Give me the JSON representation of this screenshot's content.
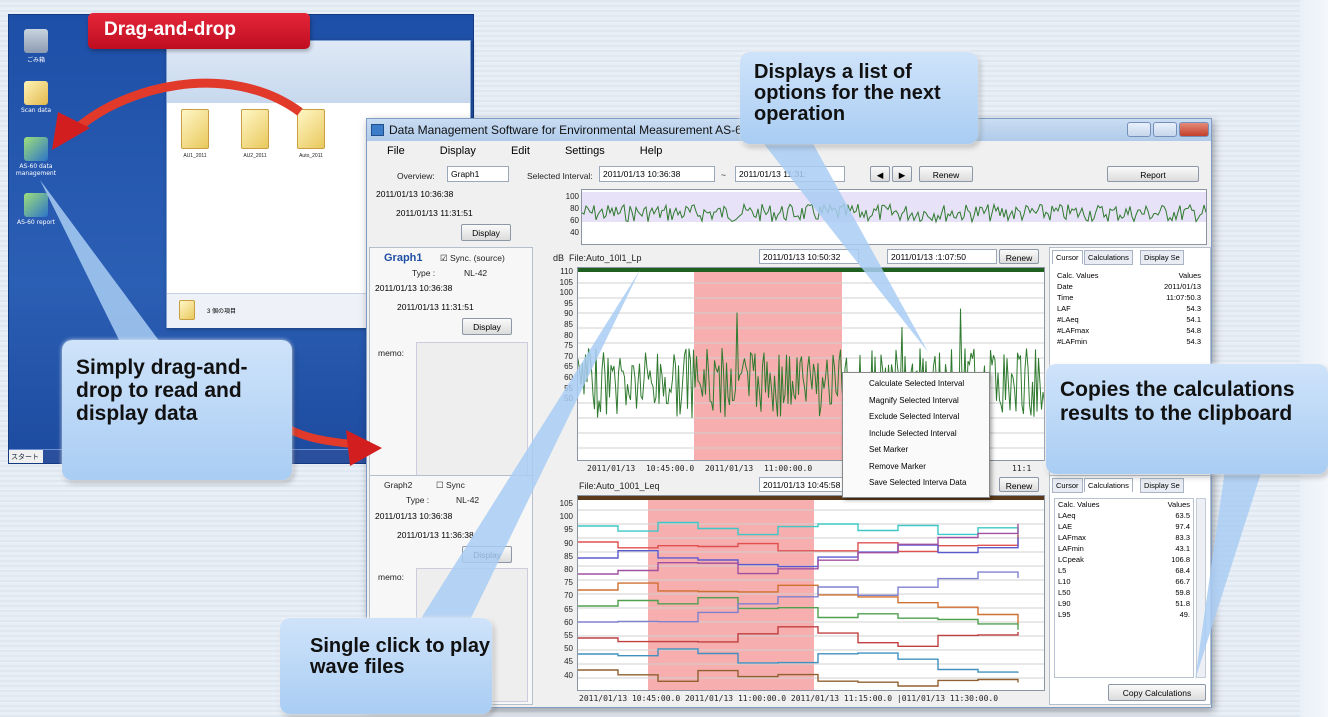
{
  "banner": {
    "drag_and_drop": "Drag-and-drop"
  },
  "callouts": {
    "options": "Displays a list of options for the next operation",
    "simply": "Simply drag-and-drop to read and display data",
    "copies": "Copies the calculations results to the clipboard",
    "single_click": "Single click to play wave files"
  },
  "window": {
    "title": "Data Management Software for Environmental Measurement AS-60 Da",
    "menu": [
      "File",
      "Display",
      "Edit",
      "Settings",
      "Help"
    ]
  },
  "overview": {
    "label": "Overview:",
    "select": "Graph1",
    "selected_interval_label": "Selected Interval:",
    "interval_from": "2011/01/13 10:36:38",
    "tilde": "~",
    "interval_to": "2011/01/13 11:31:",
    "renew": "Renew",
    "report": "Report",
    "date_from": "2011/01/13 10:36:38",
    "date_to": "2011/01/13 11:31:51",
    "display": "Display",
    "yticks": [
      "100",
      "80",
      "60",
      "40"
    ]
  },
  "graph1": {
    "title": "Graph1",
    "sync": "Sync. (source)",
    "type_label": "Type :",
    "type": "NL-42",
    "date_from": "2011/01/13 10:36:38",
    "date_to": "2011/01/13 11:31:51",
    "display": "Display",
    "memo": "memo:",
    "unit": "dB",
    "file": "File:Auto_10l1_Lp",
    "from": "2011/01/13 10:50:32",
    "to": "2011/01/13 :1:07:50",
    "renew": "Renew",
    "yticks": [
      "110",
      "105",
      "100",
      "95",
      "90",
      "85",
      "80",
      "75",
      "70",
      "65",
      "60",
      "55",
      "50"
    ],
    "xticks": [
      "2011/01/13 10:45:00.0",
      "2011/01/13 11:00:00.0",
      "11:1"
    ]
  },
  "graph2": {
    "title": "Graph2",
    "sync": "Sync",
    "type_label": "Type :",
    "type": "NL-42",
    "date_from": "2011/01/13 10:36:38",
    "date_to": "2011/01/13 11:36:38",
    "display": "Display",
    "memo": "memo:",
    "file": "File:Auto_1001_Leq",
    "from": "2011/01/13 10:45:58",
    "renew": "Renew",
    "yticks": [
      "105",
      "100",
      "95",
      "90",
      "85",
      "80",
      "75",
      "70",
      "65",
      "60",
      "55",
      "50",
      "45",
      "40"
    ],
    "xticks": "2011/01/13 10:45:00.0 2011/01/13 11:00:00.0 2011/01/13 11:15:00.0 |011/01/13 11:30:00.0"
  },
  "cursor_panel": {
    "tabs": [
      "Cursor",
      "Calculations",
      "Display Se"
    ],
    "headers": [
      "Calc. Values",
      "Values"
    ],
    "rows": [
      [
        "Date",
        "2011/01/13"
      ],
      [
        "Time",
        "11:07:50.3"
      ],
      [
        "LAF",
        "54.3"
      ],
      [
        "#LAeq",
        "54.1"
      ],
      [
        "#LAFmax",
        "54.8"
      ],
      [
        "#LAFmin",
        "54.3"
      ]
    ]
  },
  "calc_panel": {
    "tabs": [
      "Cursor",
      "Calculations",
      "Display Se"
    ],
    "headers": [
      "Calc. Values",
      "Values"
    ],
    "rows": [
      [
        "LAeq",
        "63.5"
      ],
      [
        "LAE",
        "97.4"
      ],
      [
        "LAFmax",
        "83.3"
      ],
      [
        "LAFmin",
        "43.1"
      ],
      [
        "LCpeak",
        "106.8"
      ],
      [
        "L5",
        "68.4"
      ],
      [
        "L10",
        "66.7"
      ],
      [
        "L50",
        "59.8"
      ],
      [
        "L90",
        "51.8"
      ],
      [
        "L95",
        "49."
      ]
    ],
    "copy": "Copy Calculations"
  },
  "context_menu": [
    "Calculate Selected Interval",
    "Magnify Selected Interval",
    "Exclude Selected Interval",
    "Include Selected Interval",
    "Set Marker",
    "Remove Marker",
    "Save Selected Interva Data"
  ],
  "desktop": {
    "icons": [
      "ごみ箱",
      "Scan data",
      "AS-60 data management",
      "AS-60 report"
    ],
    "start": "スタート"
  },
  "explorer": {
    "folders": [
      "AU1_2011",
      "AU2_2011",
      "Auto_2011"
    ],
    "status": "3 個の項目"
  },
  "colors": {
    "selection": "#f4a0a0",
    "wave_green": "#2f7a2f",
    "wave_brown": "#8a5a2a",
    "callout": "#b9d7f6",
    "banner": "#d4192c"
  }
}
